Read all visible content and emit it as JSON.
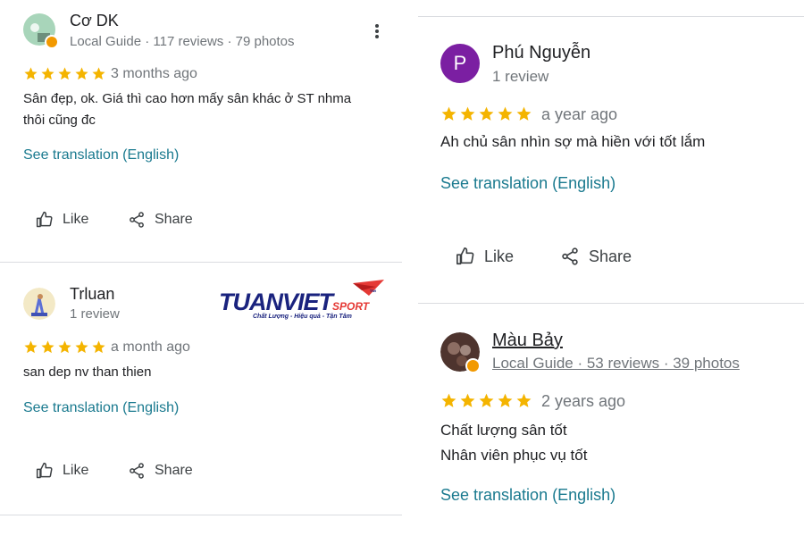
{
  "colors": {
    "star": "#f4b400",
    "link": "#1a7a8f",
    "avatar_purple": "#7b1fa2"
  },
  "reviews": [
    {
      "name": "Cơ DK",
      "meta": "Local Guide · 117 reviews · 79 photos",
      "rating": 5,
      "time": "3 months ago",
      "text": [
        "Sân đẹp, ok. Giá thì cao hơn mấy sân khác ở ST nhma",
        "thôi cũng đc"
      ],
      "translate": "See translation (English)",
      "like": "Like",
      "share": "Share"
    },
    {
      "name": "Trluan",
      "meta": "1 review",
      "rating": 5,
      "time": "a month ago",
      "text": [
        "san dep nv than thien"
      ],
      "translate": "See translation (English)",
      "like": "Like",
      "share": "Share"
    },
    {
      "name": "Phú Nguyễn",
      "avatar_letter": "P",
      "meta": "1 review",
      "rating": 5,
      "time": "a year ago",
      "text": [
        "Ah chủ sân nhìn sợ mà hiền với tốt lắm"
      ],
      "translate": "See translation (English)",
      "like": "Like",
      "share": "Share"
    },
    {
      "name": "Màu Bảy",
      "meta": "Local Guide · 53 reviews · 39 photos",
      "rating": 5,
      "time": "2 years ago",
      "text": [
        "Chất lượng sân tốt",
        "Nhân viên phục vụ tốt"
      ],
      "translate": "See translation (English)"
    }
  ],
  "logo": {
    "brand": "TUANVIET",
    "sub": "SPORT",
    "tm": "™",
    "tagline": "Chất Lượng - Hiệu quả - Tận Tâm"
  }
}
